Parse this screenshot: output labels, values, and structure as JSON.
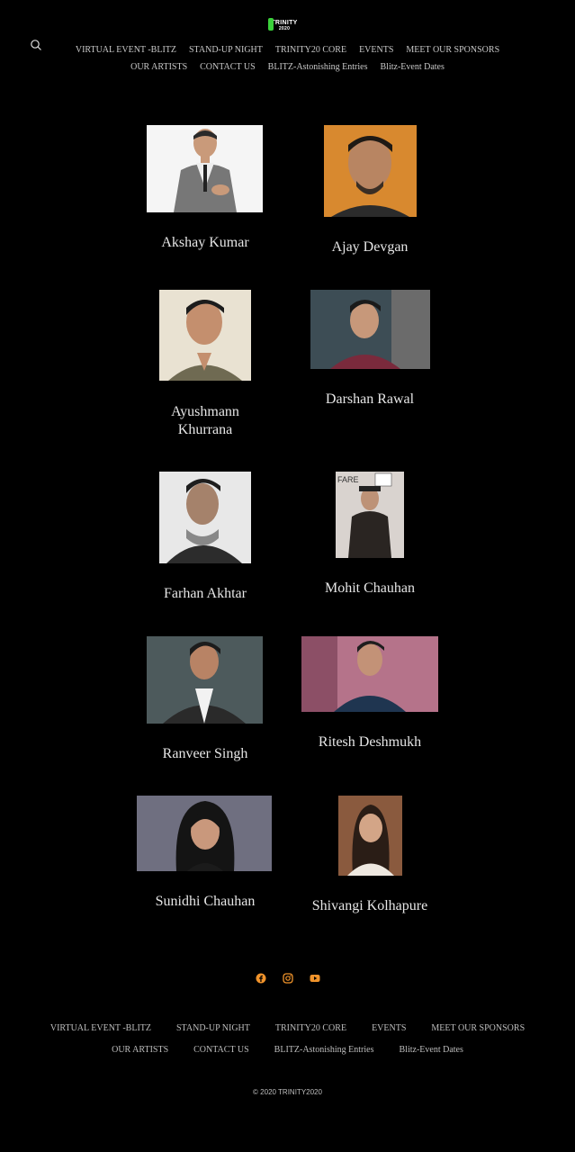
{
  "header": {
    "logo_text": "TRINITY",
    "logo_sub": "2020",
    "nav_row_1": [
      "VIRTUAL EVENT -BLITZ",
      "STAND-UP NIGHT",
      "TRINITY20 CORE",
      "EVENTS",
      "MEET OUR SPONSORS"
    ],
    "nav_row_2": [
      "OUR ARTISTS",
      "CONTACT US",
      "BLITZ-Astonishing Entries",
      "Blitz-Event Dates"
    ]
  },
  "artists": [
    {
      "name": "Akshay Kumar"
    },
    {
      "name": "Ajay Devgan"
    },
    {
      "name": "Ayushmann Khurrana"
    },
    {
      "name": "Darshan Rawal"
    },
    {
      "name": "Farhan Akhtar"
    },
    {
      "name": "Mohit Chauhan"
    },
    {
      "name": "Ranveer Singh"
    },
    {
      "name": "Ritesh Deshmukh"
    },
    {
      "name": "Sunidhi Chauhan"
    },
    {
      "name": "Shivangi Kolhapure"
    }
  ],
  "social": [
    "facebook-icon",
    "instagram-icon",
    "youtube-icon"
  ],
  "colors": {
    "accent": "#f0932b",
    "background": "#000000"
  },
  "footer": {
    "nav_row_1": [
      "VIRTUAL EVENT -BLITZ",
      "STAND-UP NIGHT",
      "TRINITY20 CORE",
      "EVENTS",
      "MEET OUR SPONSORS"
    ],
    "nav_row_2": [
      "OUR ARTISTS",
      "CONTACT US",
      "BLITZ-Astonishing Entries",
      "Blitz-Event Dates"
    ],
    "copyright": "© 2020  TRINITY2020"
  }
}
